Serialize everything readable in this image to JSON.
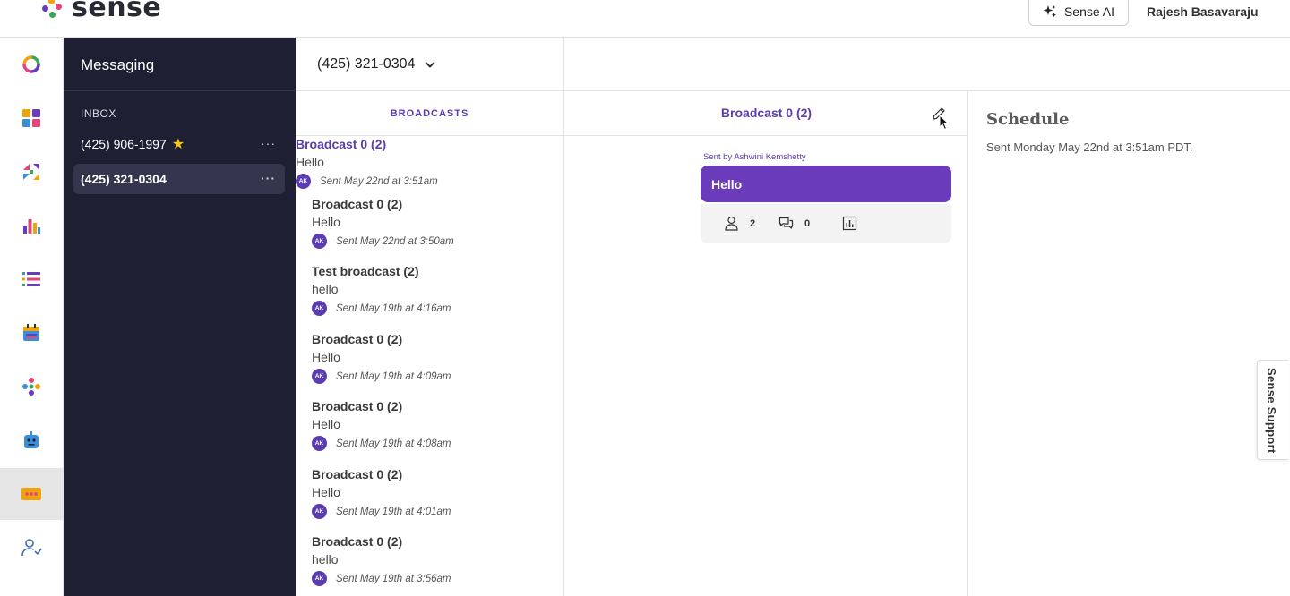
{
  "topbar": {
    "logo_text": "sense",
    "ai_button_label": "Sense AI",
    "user_name": "Rajesh Basavaraju"
  },
  "rail": {
    "items": [
      {
        "icon": "donut-chart-icon"
      },
      {
        "icon": "dashboard-grid-icon"
      },
      {
        "icon": "arrows-exchange-icon"
      },
      {
        "icon": "bar-chart-icon"
      },
      {
        "icon": "list-icon"
      },
      {
        "icon": "calendar-icon"
      },
      {
        "icon": "people-network-icon"
      },
      {
        "icon": "robot-icon"
      },
      {
        "icon": "messaging-icon",
        "active": true
      },
      {
        "icon": "user-check-icon"
      }
    ]
  },
  "sidebar": {
    "title": "Messaging",
    "section_label": "INBOX",
    "items": [
      {
        "label": "(425) 906-1997",
        "starred": true,
        "menu": "···"
      },
      {
        "label": "(425) 321-0304",
        "selected": true,
        "menu": "···"
      }
    ]
  },
  "header": {
    "phone_selector": "(425) 321-0304"
  },
  "broadcasts": {
    "column_title": "BROADCASTS",
    "items": [
      {
        "title": "Broadcast 0 (2)",
        "body": "Hello",
        "avatar": "AK",
        "meta": "Sent May 22nd at 3:51am"
      },
      {
        "title": "Broadcast 0 (2)",
        "body": "Hello",
        "avatar": "AK",
        "meta": "Sent May 22nd at 3:50am"
      },
      {
        "title": "Test broadcast (2)",
        "body": "hello",
        "avatar": "AK",
        "meta": "Sent May 19th at 4:16am"
      },
      {
        "title": "Broadcast 0 (2)",
        "body": "Hello",
        "avatar": "AK",
        "meta": "Sent May 19th at 4:09am"
      },
      {
        "title": "Broadcast 0 (2)",
        "body": "Hello",
        "avatar": "AK",
        "meta": "Sent May 19th at 4:08am"
      },
      {
        "title": "Broadcast 0 (2)",
        "body": "Hello",
        "avatar": "AK",
        "meta": "Sent May 19th at 4:01am"
      },
      {
        "title": "Broadcast 0 (2)",
        "body": "hello",
        "avatar": "AK",
        "meta": "Sent May 19th at 3:56am"
      }
    ]
  },
  "detail": {
    "title": "Broadcast 0 (2)",
    "sent_by": "Sent by Ashwini Kemshetty",
    "message": "Hello",
    "recipients_count": "2",
    "replies_count": "0"
  },
  "schedule": {
    "title": "Schedule",
    "text": "Sent Monday May 22nd at 3:51am PDT."
  },
  "support": {
    "label": "Sense Support"
  },
  "colors": {
    "accent": "#5b3db0",
    "bubble": "#6a3bbb",
    "sidebar_bg": "#1f1f33"
  }
}
